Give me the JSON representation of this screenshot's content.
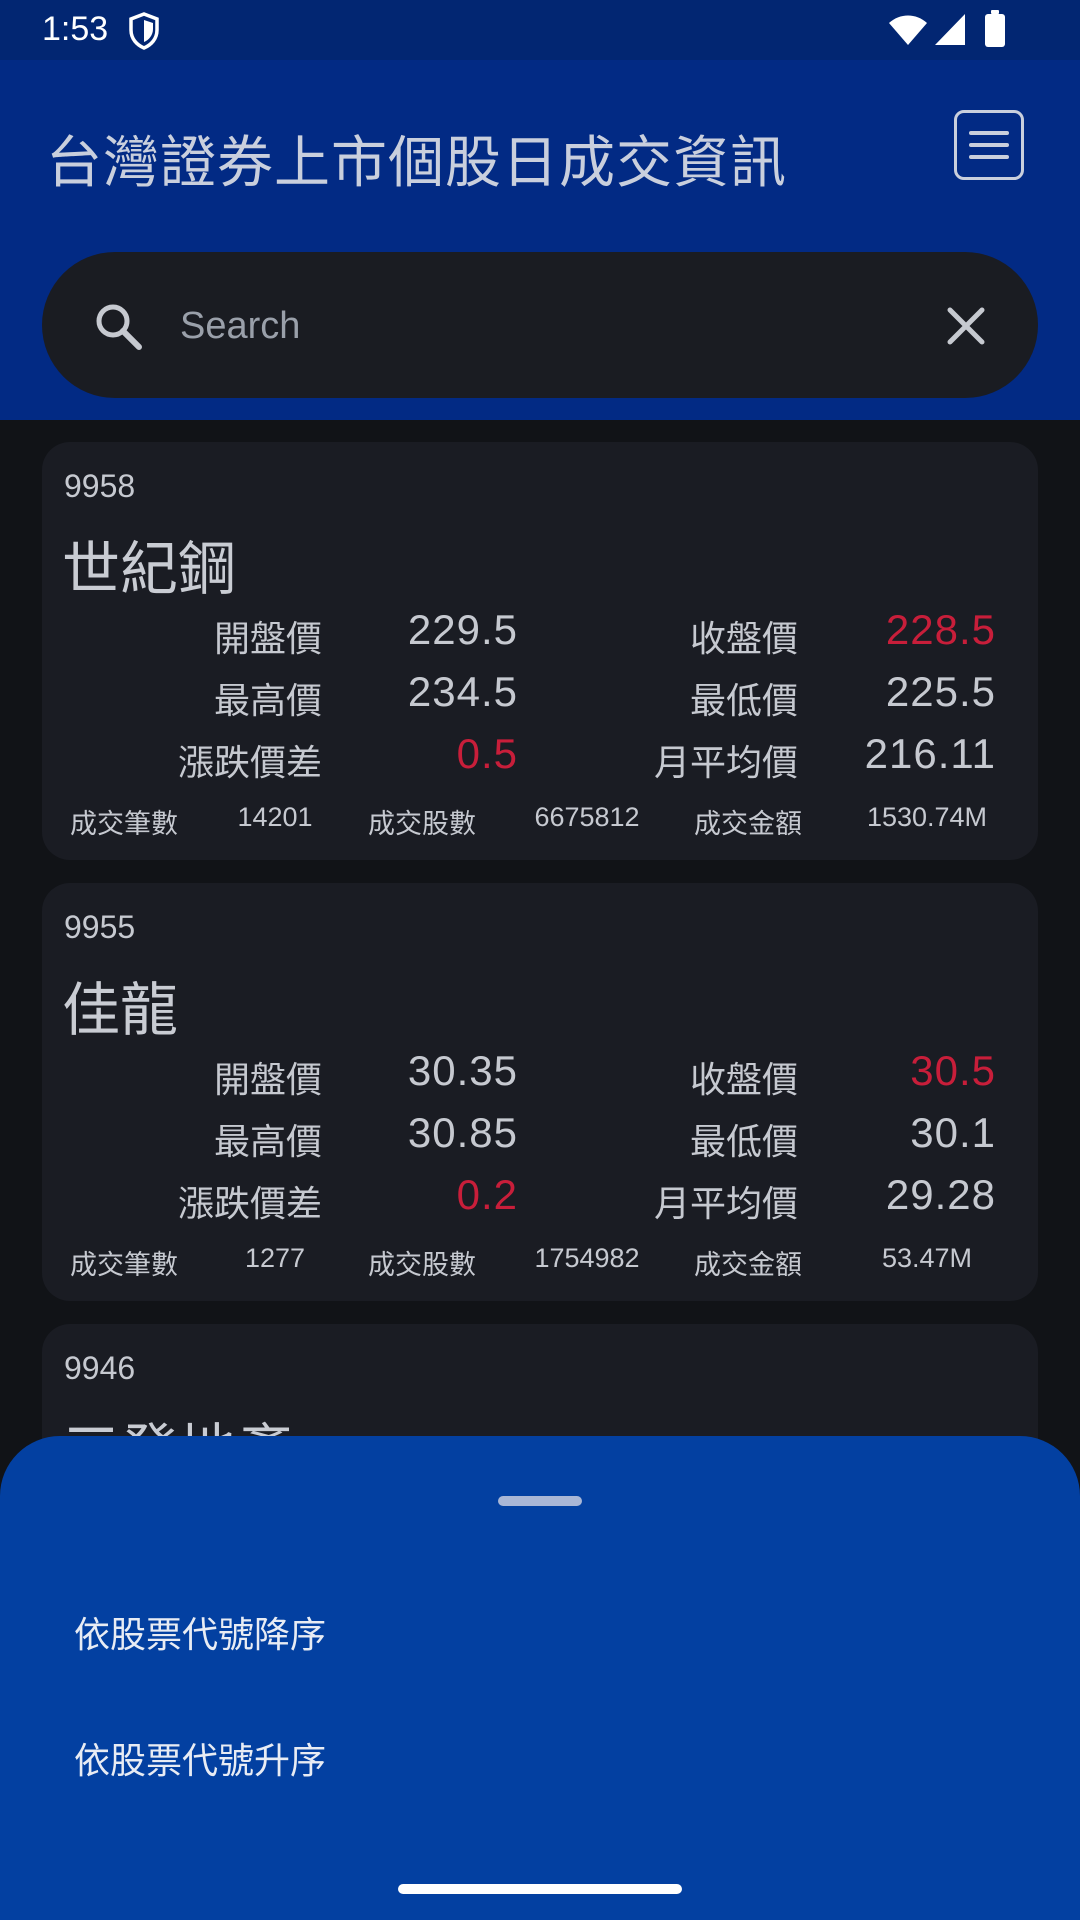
{
  "status_bar": {
    "time": "1:53"
  },
  "app_bar": {
    "title": "台灣證券上市個股日成交資訊"
  },
  "search": {
    "placeholder": "Search"
  },
  "labels": {
    "open": "開盤價",
    "close": "收盤價",
    "high": "最高價",
    "low": "最低價",
    "change": "漲跌價差",
    "month_avg": "月平均價",
    "trades": "成交筆數",
    "shares": "成交股數",
    "amount": "成交金額"
  },
  "stocks": [
    {
      "code": "9958",
      "name": "世紀鋼",
      "open": "229.5",
      "close": "228.5",
      "high": "234.5",
      "low": "225.5",
      "change": "0.5",
      "month_avg": "216.11",
      "trades": "14201",
      "shares": "6675812",
      "amount": "1530.74M"
    },
    {
      "code": "9955",
      "name": "佳龍",
      "open": "30.35",
      "close": "30.5",
      "high": "30.85",
      "low": "30.1",
      "change": "0.2",
      "month_avg": "29.28",
      "trades": "1277",
      "shares": "1754982",
      "amount": "53.47M"
    },
    {
      "code": "9946",
      "name": "三發地產"
    }
  ],
  "sort_sheet": {
    "options": [
      "依股票代號降序",
      "依股票代號升序"
    ]
  },
  "colors": {
    "status_bar": "#022672",
    "app_bar": "#022a84",
    "background": "#111317",
    "card": "#1a1c23",
    "price_up": "#c81e3a",
    "sheet": "#0340a1"
  }
}
